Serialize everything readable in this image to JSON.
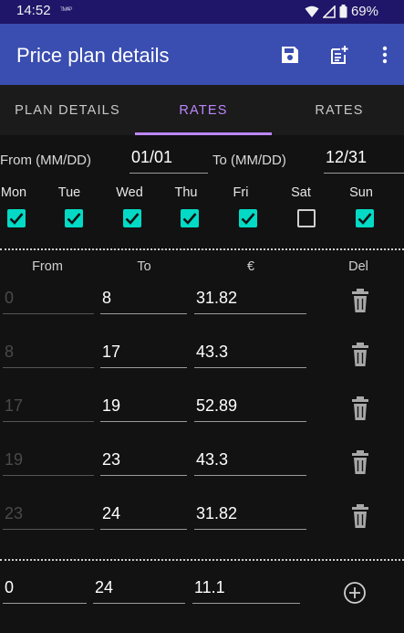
{
  "status": {
    "time": "14:52",
    "notification": "ᵀᴹᴬᴾ",
    "battery": "69%"
  },
  "appbar": {
    "title": "Price plan details",
    "save_icon": "save-icon",
    "add_icon": "add-note-icon",
    "more_icon": "more-vertical-icon"
  },
  "tabs": [
    {
      "label": "PLAN DETAILS",
      "active": false
    },
    {
      "label": "RATES",
      "active": true
    },
    {
      "label": "RATES",
      "active": false
    }
  ],
  "dates": {
    "from_label": "From (MM/DD)",
    "from_value": "01/01",
    "to_label": "To (MM/DD)",
    "to_value": "12/31"
  },
  "days": [
    {
      "label": "Mon",
      "checked": true
    },
    {
      "label": "Tue",
      "checked": true
    },
    {
      "label": "Wed",
      "checked": true
    },
    {
      "label": "Thu",
      "checked": true
    },
    {
      "label": "Fri",
      "checked": true
    },
    {
      "label": "Sat",
      "checked": false
    },
    {
      "label": "Sun",
      "checked": true
    }
  ],
  "table": {
    "headers": [
      "From",
      "To",
      "€",
      "Del"
    ],
    "rows": [
      {
        "from": "0",
        "to": "8",
        "price": "31.82"
      },
      {
        "from": "8",
        "to": "17",
        "price": "43.3"
      },
      {
        "from": "17",
        "to": "19",
        "price": "52.89"
      },
      {
        "from": "19",
        "to": "23",
        "price": "43.3"
      },
      {
        "from": "23",
        "to": "24",
        "price": "31.82"
      }
    ]
  },
  "new_row": {
    "from": "0",
    "to": "24",
    "price": "11.1"
  },
  "colors": {
    "statusbar": "#1f1669",
    "appbar": "#3a4db0",
    "accent": "#bb86fc",
    "checkbox": "#03dac5",
    "background": "#121212"
  }
}
